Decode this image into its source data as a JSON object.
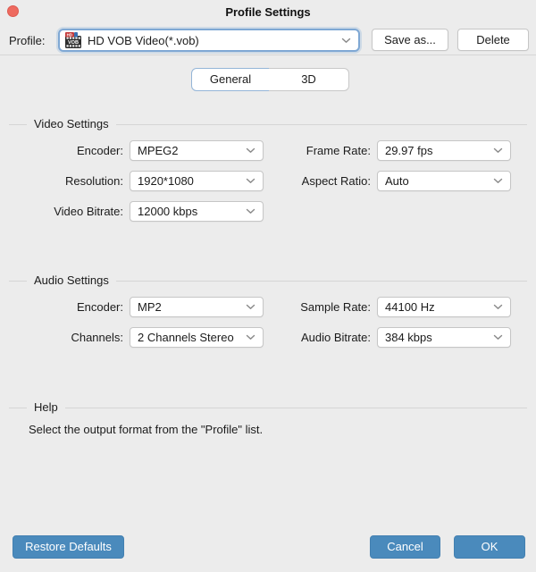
{
  "window": {
    "title": "Profile Settings"
  },
  "profile_row": {
    "label": "Profile:",
    "value": "HD VOB Video(*.vob)",
    "icon_badge": "HD",
    "icon_text": "VOB",
    "save_as_label": "Save as...",
    "delete_label": "Delete"
  },
  "tabs": [
    {
      "label": "General",
      "selected": true
    },
    {
      "label": "3D",
      "selected": false
    }
  ],
  "sections": {
    "video": {
      "title": "Video Settings",
      "fields": [
        {
          "label": "Encoder:",
          "value": "MPEG2"
        },
        {
          "label": "Frame Rate:",
          "value": "29.97 fps"
        },
        {
          "label": "Resolution:",
          "value": "1920*1080"
        },
        {
          "label": "Aspect Ratio:",
          "value": "Auto"
        },
        {
          "label": "Video Bitrate:",
          "value": "12000 kbps"
        }
      ]
    },
    "audio": {
      "title": "Audio Settings",
      "fields": [
        {
          "label": "Encoder:",
          "value": "MP2"
        },
        {
          "label": "Sample Rate:",
          "value": "44100 Hz"
        },
        {
          "label": "Channels:",
          "value": "2 Channels Stereo"
        },
        {
          "label": "Audio Bitrate:",
          "value": "384 kbps"
        }
      ]
    },
    "help": {
      "title": "Help",
      "text": "Select the output format from the \"Profile\" list."
    }
  },
  "footer": {
    "restore_defaults_label": "Restore Defaults",
    "cancel_label": "Cancel",
    "ok_label": "OK"
  },
  "colors": {
    "window_bg": "#ececec",
    "close_red": "#ee6a5f",
    "focus_ring_blue": "#7fa8d4",
    "selected_tab_border": "#94b5d7",
    "action_button_blue": "#4a8abc"
  }
}
